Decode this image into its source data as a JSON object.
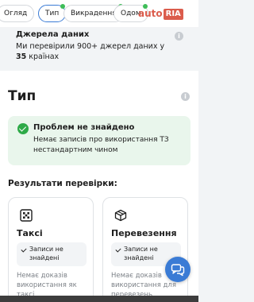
{
  "tabs": [
    {
      "label": "Огляд",
      "active": false,
      "dot": false
    },
    {
      "label": "Тип",
      "active": true,
      "dot": true
    },
    {
      "label": "Викрадення",
      "active": false,
      "dot": true
    },
    {
      "label": "Одом",
      "active": false,
      "dot": true
    }
  ],
  "logo": {
    "brand": "auto",
    "badge": "RIA"
  },
  "sources": {
    "title": "Джерела даних",
    "text_before": "Ми перевірили 900+ джерел даних у ",
    "count": "35",
    "text_after": " країнах"
  },
  "type_section": {
    "title": "Тип"
  },
  "alert": {
    "title": "Проблем не знайдено",
    "text": "Немає записів про використання ТЗ нестандартним чином",
    "color": "#2eaa48"
  },
  "results": {
    "label": "Результати перевірки:",
    "cards": [
      {
        "icon": "taxi-icon",
        "title": "Таксі",
        "badge": "Записи не знайдені",
        "desc": "Немає доказів використання як таксі"
      },
      {
        "icon": "box-icon",
        "title": "Перевезення",
        "badge": "Записи не знайдені",
        "desc": "Немає доказів використання для перевезень"
      }
    ]
  },
  "colors": {
    "accent": "#3a7bd5",
    "success": "#2eaa48",
    "brand": "#db5c4c"
  }
}
